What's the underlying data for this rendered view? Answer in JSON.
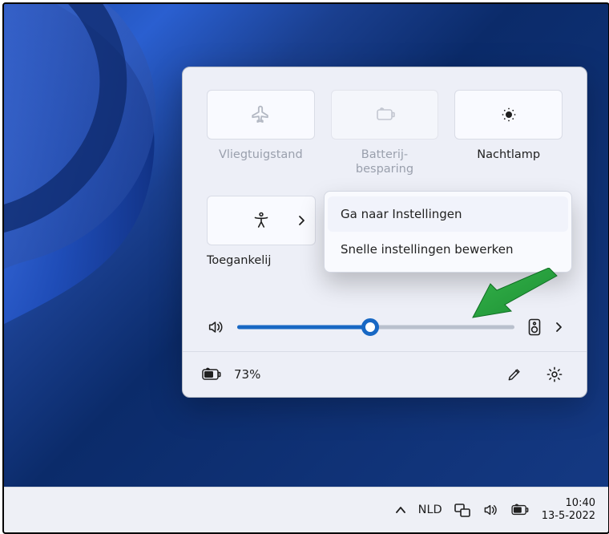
{
  "quick_settings": {
    "tiles": [
      {
        "name": "airplane-mode",
        "label": "Vliegtuigstand",
        "state": "off"
      },
      {
        "name": "battery-saver",
        "label": "Batterij-\nbesparing",
        "state": "disabled"
      },
      {
        "name": "night-light",
        "label": "Nachtlamp",
        "state": "off"
      }
    ],
    "row2_tile": {
      "name": "accessibility",
      "label": "Toegankelij"
    },
    "context_menu": {
      "items": [
        "Ga naar Instellingen",
        "Snelle instellingen bewerken"
      ]
    },
    "volume": {
      "percent": 48
    },
    "battery_label": "73%"
  },
  "taskbar": {
    "language": "NLD",
    "clock_time": "10:40",
    "clock_date": "13-5-2022"
  }
}
